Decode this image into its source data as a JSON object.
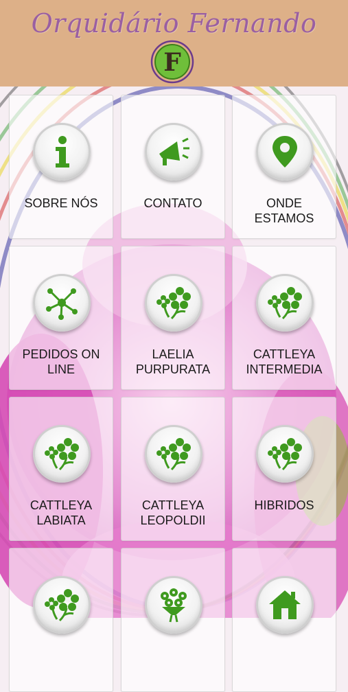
{
  "header": {
    "title": "Orquidário Fernando",
    "logo_letter": "F"
  },
  "colors": {
    "header_bg": "#ddb088",
    "title": "#9a5fa2",
    "icon_green": "#3f9a1f",
    "orchid_pink": "#d94fb9"
  },
  "menu": [
    {
      "label": "SOBRE NÓS",
      "icon": "info-icon"
    },
    {
      "label": "CONTATO",
      "icon": "megaphone-icon"
    },
    {
      "label": "ONDE\nESTAMOS",
      "icon": "location-pin-icon"
    },
    {
      "label": "PEDIDOS ON\nLINE",
      "icon": "network-icon"
    },
    {
      "label": "LAELIA\nPURPURATA",
      "icon": "flower-icon"
    },
    {
      "label": "CATTLEYA\nINTERMEDIA",
      "icon": "flower-icon"
    },
    {
      "label": "CATTLEYA\nLABIATA",
      "icon": "flower-icon"
    },
    {
      "label": "CATTLEYA\nLEOPOLDII",
      "icon": "flower-icon"
    },
    {
      "label": "HIBRIDOS",
      "icon": "flower-icon"
    },
    {
      "label": "",
      "icon": "flower-icon"
    },
    {
      "label": "",
      "icon": "bouquet-icon"
    },
    {
      "label": "",
      "icon": "home-icon"
    }
  ]
}
